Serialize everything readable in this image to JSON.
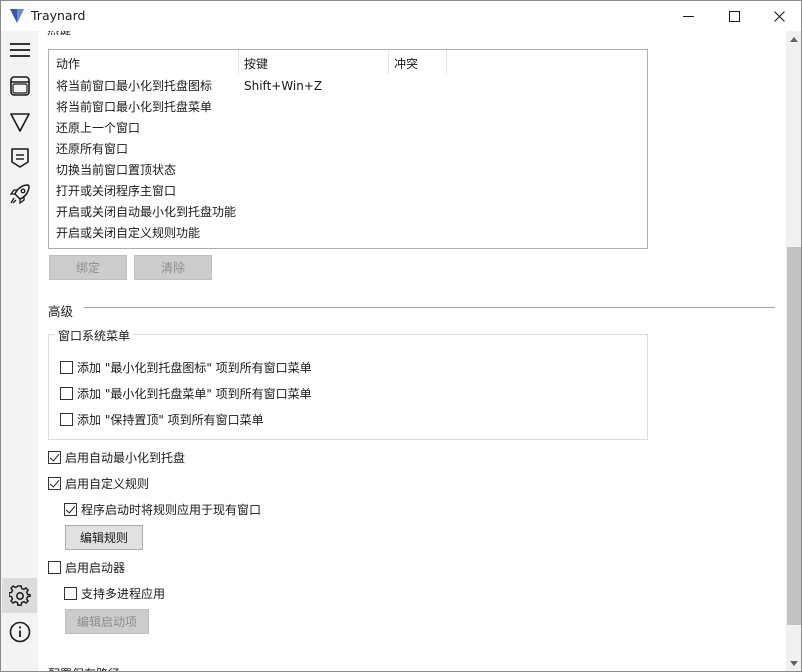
{
  "app": {
    "title": "Traynard"
  },
  "colors": {
    "logo": "#3b57a8",
    "thumb": "#c2c2c2",
    "active_nav": "#dcdcdc"
  },
  "sidebar": {
    "items": [
      {
        "icon": "menu-icon"
      },
      {
        "icon": "window-icon"
      },
      {
        "icon": "filter-icon"
      },
      {
        "icon": "rules-icon"
      },
      {
        "icon": "rocket-icon"
      }
    ],
    "bottom_items": [
      {
        "icon": "gear-icon",
        "active": true
      },
      {
        "icon": "info-icon"
      }
    ]
  },
  "hotkeys": {
    "columns": [
      "动作",
      "按键",
      "冲突"
    ],
    "rows": [
      {
        "action": "将当前窗口最小化到托盘图标",
        "key": "Shift+Win+Z"
      },
      {
        "action": "将当前窗口最小化到托盘菜单",
        "key": ""
      },
      {
        "action": "还原上一个窗口",
        "key": ""
      },
      {
        "action": "还原所有窗口",
        "key": ""
      },
      {
        "action": "切换当前窗口置顶状态",
        "key": ""
      },
      {
        "action": "打开或关闭程序主窗口",
        "key": ""
      },
      {
        "action": "开启或关闭自动最小化到托盘功能",
        "key": ""
      },
      {
        "action": "开启或关闭自定义规则功能",
        "key": ""
      }
    ],
    "bind_label": "绑定",
    "clear_label": "清除"
  },
  "advanced": {
    "title": "高级",
    "system_menu": {
      "label": "窗口系统菜单",
      "options": [
        {
          "label": "添加 \"最小化到托盘图标\" 项到所有窗口菜单",
          "checked": false
        },
        {
          "label": "添加 \"最小化到托盘菜单\" 项到所有窗口菜单",
          "checked": false
        },
        {
          "label": "添加 \"保持置顶\" 项到所有窗口菜单",
          "checked": false
        }
      ]
    },
    "auto_minimize": {
      "label": "启用自动最小化到托盘",
      "checked": true
    },
    "custom_rules": {
      "label": "启用自定义规则",
      "checked": true
    },
    "apply_on_start": {
      "label": "程序启动时将规则应用于现有窗口",
      "checked": true
    },
    "edit_rules_label": "编辑规则",
    "launcher": {
      "label": "启用启动器",
      "checked": false
    },
    "multi_process": {
      "label": "支持多进程应用",
      "checked": false
    },
    "edit_launch_label": "编辑启动项"
  }
}
